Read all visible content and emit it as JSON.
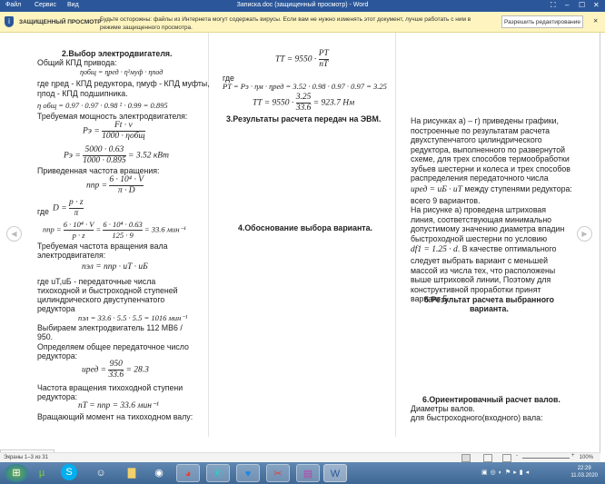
{
  "titlebar": {
    "menu": [
      "Файл",
      "Сервис",
      "Вид"
    ],
    "title": "Записка.doc (защищенный просмотр) - Word"
  },
  "infobar": {
    "label": "ЗАЩИЩЕННЫЙ ПРОСМОТР",
    "message": "Будьте осторожны: файлы из Интернета могут содержать вирусы. Если вам не нужно изменять этот документ, лучше работать с ним в режиме защищенного просмотра.",
    "button": "Разрешить редактирование"
  },
  "col1": {
    "h2": "2.Выбор электродвигателя.",
    "l1": "Общий КПД привода:",
    "f1": "ηобщ = ηред · η²муф · ηпод",
    "l2": "где ηред - КПД редуктора, ηмуф - КПД муфты,",
    "l3": "ηпод - КПД подшипника.",
    "f2": "η общ = 0.97 · 0.97 · 0.98 ² · 0.99 = 0.895",
    "l4": "Требуемая мощность электродвигателя:",
    "f3a": "Pэ =",
    "f3n": "Ft · v",
    "f3d": "1000 · ηобщ",
    "f4a": "Pэ =",
    "f4n": "5000 · 0.63",
    "f4d": "1000 · 0.895",
    "f4b": "= 3.52  кВт",
    "l5": "Приведенная частота вращения:",
    "f5a": "nпр =",
    "f5n": "6 · 10⁴ · V",
    "f5d": "π · D",
    "l6": "где",
    "f6a": "D =",
    "f6n": "p · z",
    "f6d": "π",
    "f7a": "nпр =",
    "f7n": "6 · 10⁴ · V",
    "f7d": "p · z",
    "f7m": "=",
    "f7n2": "6 · 10⁴ · 0.63",
    "f7d2": "125 · 9",
    "f7b": "= 33.6  мин⁻¹",
    "l7": "Требуемая частота вращения вала",
    "l8": "электродвигателя:",
    "f8": "nэл = nпр · uT · uБ",
    "l9": "где uT,uБ - передаточные числа",
    "l10": "тихоходной и быстроходной ступеней",
    "l11": "цилиндрического двуступенчатого",
    "l12": "редуктора",
    "f9": "nэл = 33.6 · 5.5 · 5.5 = 1016 мин⁻¹",
    "l13": "Выбираем электродвигатель  112 МВ6 /",
    "l14": "950.",
    "l15": "Определяем общее передаточное число",
    "l16": "редуктора:",
    "f10a": "uред =",
    "f10n": "950",
    "f10d": "33.6",
    "f10b": "= 28.3",
    "l17": "Частота вращения тихоходной ступени",
    "l18": "редуктора:",
    "f11": "nT = nпр = 33.6  мин⁻¹",
    "l19": "Вращающий момент на тихоходном валу:"
  },
  "col2": {
    "f1a": "TT = 9550 ·",
    "f1n": "PT",
    "f1d": "nT",
    "l1": "где",
    "f2": "PT = Pэ · ηм · ηред = 3.52 · 0.98 · 0.97 · 0.97 = 3.25",
    "f3a": "TT = 9550 ·",
    "f3n": "3.25",
    "f3d": "33.6",
    "f3b": "= 923.7  Нм",
    "h3": "3.Результаты расчета передач на ЭВМ.",
    "h4": "4.Обоснование выбора варианта."
  },
  "col3": {
    "lines": [
      "На рисунках а) – г) приведены графики,",
      "построенные по результатам расчета",
      "двухступенчатого цилиндрического",
      "редуктора, выполненного по развернутой",
      "схеме, для трех способов термообработки",
      "зубьев шестерни и колеса и трех способов",
      "распределения передаточного числа"
    ],
    "f1": "uред = uБ · uT",
    "f1t": " между ступенями редуктора:",
    "lines2": [
      "всего 9 вариантов.",
      "На рисунке а) проведена штриховая",
      "линия, соответствующая минимально",
      "допустимому значению диаметра впадин",
      "быстроходной шестерни по условию"
    ],
    "f2": "df1 = 1.25 · d",
    "f2t": ". В качестве оптимального",
    "lines3": [
      "следует выбрать вариант с меньшей",
      "массой из числа тех, что расположены",
      "выше штриховой линии, Поэтому для",
      "конструктивной проработки принят",
      "вариант 5."
    ],
    "h5a": "5.Результат расчета выбранного",
    "h5b": "варианта.",
    "h6": "6.Ориентировачный расчет валов.",
    "l1": "Диаметры валов.",
    "l2": "для быстроходного(входного) вала:"
  },
  "status": {
    "pages": "Экраны 1–3 из 31",
    "zoom": "100%"
  },
  "taskbar": {
    "time": "22:29",
    "date": "11.03.2020"
  }
}
